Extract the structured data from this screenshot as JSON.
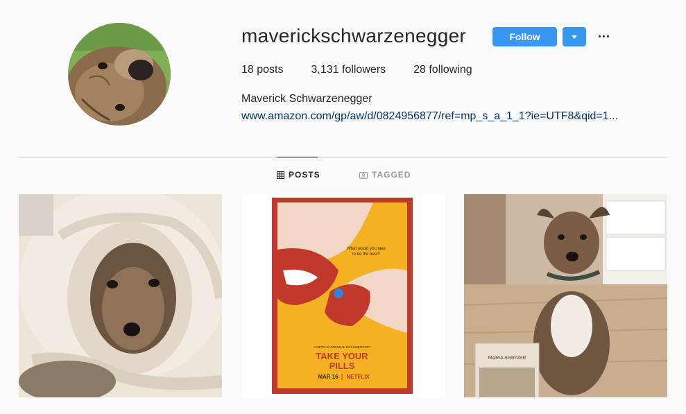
{
  "profile": {
    "username": "maverickschwarzenegger",
    "full_name": "Maverick Schwarzenegger",
    "website": "www.amazon.com/gp/aw/d/0824956877/ref=mp_s_a_1_1?ie=UTF8&qid=1...",
    "avatar_icon": "profile-photo-dog"
  },
  "actions": {
    "follow_label": "Follow",
    "dropdown_icon": "chevron-down-icon",
    "more_icon": "more-options-icon"
  },
  "stats": {
    "posts": "18 posts",
    "followers": "3,131 followers",
    "following": "28 following"
  },
  "tabs": [
    {
      "label": "POSTS",
      "icon": "grid-icon",
      "active": true
    },
    {
      "label": "TAGGED",
      "icon": "tagged-icon",
      "active": false
    }
  ],
  "posts": [
    {
      "image": "dog-in-blanket-photo"
    },
    {
      "image": "documentary-poster",
      "poster": {
        "tagline_1": "What would you take",
        "tagline_2": "to be the best?",
        "eyebrow": "A NETFLIX ORIGINAL DOCUMENTARY",
        "title_1": "TAKE YOUR",
        "title_2": "PILLS",
        "date": "MAR 16",
        "network": "NETFLIX"
      }
    },
    {
      "image": "dog-with-book-photo",
      "book_author": "MARIA SHRIVER"
    }
  ],
  "colors": {
    "follow_blue": "#3897f0",
    "link_blue": "#003569",
    "poster_yellow": "#f4b223",
    "poster_red": "#c0392b"
  }
}
